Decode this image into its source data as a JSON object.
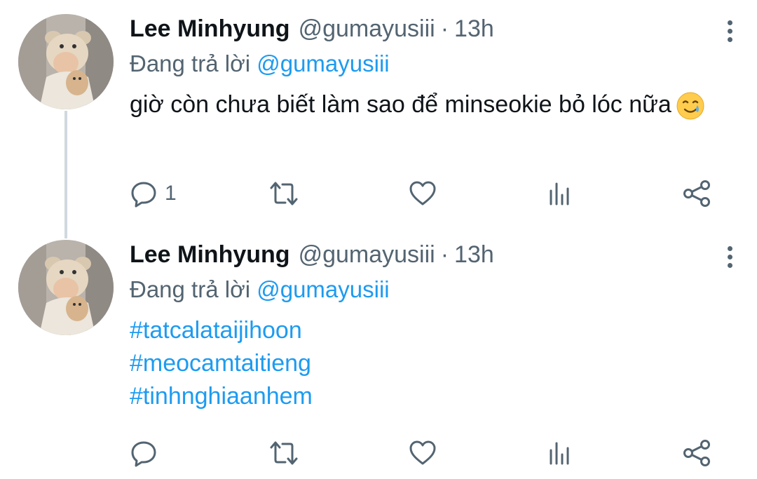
{
  "colors": {
    "primary_text": "#0f1419",
    "secondary_text": "#536471",
    "accent": "#1d9bf0",
    "thread_line": "#cfd9de",
    "background": "#ffffff"
  },
  "tweets": [
    {
      "author_name": "Lee Minhyung",
      "handle": "@gumayusiii",
      "separator": "·",
      "time": "13h",
      "replying_prefix": "Đang trả lời",
      "replying_to": "@gumayusiii",
      "text": "giờ còn chưa biết làm sao để minseokie bỏ lóc nữa",
      "emoji": "smiling-face-with-tear",
      "hashtags": [],
      "reply_count": "1",
      "retweet_count": "",
      "like_count": "",
      "icons": [
        "reply-icon",
        "retweet-icon",
        "like-icon",
        "stats-icon",
        "share-icon",
        "more-icon"
      ]
    },
    {
      "author_name": "Lee Minhyung",
      "handle": "@gumayusiii",
      "separator": "·",
      "time": "13h",
      "replying_prefix": "Đang trả lời",
      "replying_to": "@gumayusiii",
      "text": "",
      "hashtags": [
        "#tatcalataijihoon",
        "#meocamtaitieng",
        "#tinhnghiaanhem"
      ],
      "reply_count": "",
      "retweet_count": "",
      "like_count": "",
      "icons": [
        "reply-icon",
        "retweet-icon",
        "like-icon",
        "stats-icon",
        "share-icon",
        "more-icon"
      ]
    }
  ]
}
